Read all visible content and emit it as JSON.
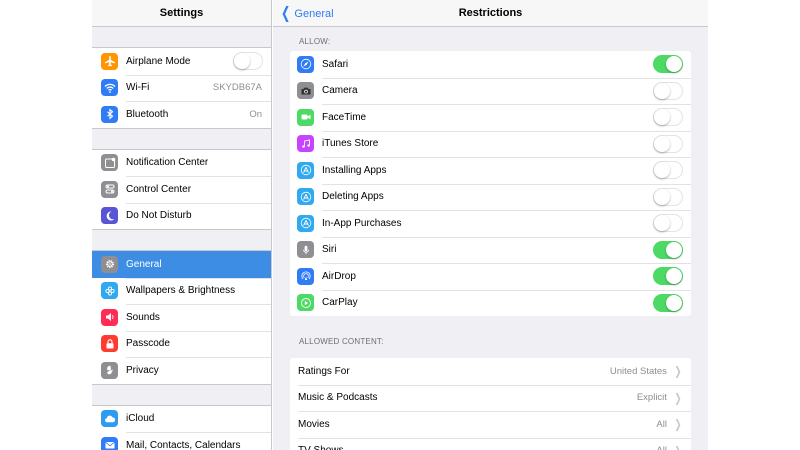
{
  "sidebar": {
    "title": "Settings",
    "groups": [
      [
        {
          "label": "Airplane Mode",
          "icon": "airplane-icon",
          "color": "#ff9500",
          "toggle": "off"
        },
        {
          "label": "Wi-Fi",
          "icon": "wifi-icon",
          "color": "#2f7cf6",
          "value": "SKYDB67A"
        },
        {
          "label": "Bluetooth",
          "icon": "bluetooth-icon",
          "color": "#2f7cf6",
          "value": "On"
        }
      ],
      [
        {
          "label": "Notification Center",
          "icon": "notification-center-icon",
          "color": "#8e8e93"
        },
        {
          "label": "Control Center",
          "icon": "control-center-icon",
          "color": "#8e8e93"
        },
        {
          "label": "Do Not Disturb",
          "icon": "moon-icon",
          "color": "#5856d6"
        }
      ],
      [
        {
          "label": "General",
          "icon": "gear-icon",
          "color": "#8e8e93",
          "selected": true
        },
        {
          "label": "Wallpapers & Brightness",
          "icon": "wallpaper-icon",
          "color": "#2fa9f0"
        },
        {
          "label": "Sounds",
          "icon": "speaker-icon",
          "color": "#ff2d55"
        },
        {
          "label": "Passcode",
          "icon": "lock-icon",
          "color": "#ff3b30"
        },
        {
          "label": "Privacy",
          "icon": "hand-icon",
          "color": "#8e8e93"
        }
      ],
      [
        {
          "label": "iCloud",
          "icon": "cloud-icon",
          "color": "#2f9bf0"
        },
        {
          "label": "Mail, Contacts, Calendars",
          "icon": "mail-icon",
          "color": "#2f7cf6"
        }
      ]
    ]
  },
  "main": {
    "back_label": "General",
    "title": "Restrictions",
    "allow_header": "ALLOW:",
    "allow": [
      {
        "label": "Safari",
        "icon": "safari-icon",
        "color": "#2f7cf6",
        "toggle": "on"
      },
      {
        "label": "Camera",
        "icon": "camera-icon",
        "color": "#8e8e93",
        "toggle": "off"
      },
      {
        "label": "FaceTime",
        "icon": "facetime-icon",
        "color": "#4cd964",
        "toggle": "off"
      },
      {
        "label": "iTunes Store",
        "icon": "itunes-icon",
        "color": "#c644fc",
        "toggle": "off"
      },
      {
        "label": "Installing Apps",
        "icon": "app-store-icon",
        "color": "#2fa9f0",
        "toggle": "off"
      },
      {
        "label": "Deleting Apps",
        "icon": "app-store-icon",
        "color": "#2fa9f0",
        "toggle": "off"
      },
      {
        "label": "In-App Purchases",
        "icon": "app-store-icon",
        "color": "#2fa9f0",
        "toggle": "off"
      },
      {
        "label": "Siri",
        "icon": "microphone-icon",
        "color": "#8e8e93",
        "toggle": "on"
      },
      {
        "label": "AirDrop",
        "icon": "airdrop-icon",
        "color": "#2f7cf6",
        "toggle": "on"
      },
      {
        "label": "CarPlay",
        "icon": "carplay-icon",
        "color": "#4cd964",
        "toggle": "on"
      }
    ],
    "content_header": "ALLOWED CONTENT:",
    "content": [
      {
        "label": "Ratings For",
        "value": "United States"
      },
      {
        "label": "Music & Podcasts",
        "value": "Explicit"
      },
      {
        "label": "Movies",
        "value": "All"
      },
      {
        "label": "TV Shows",
        "value": "All"
      }
    ]
  }
}
